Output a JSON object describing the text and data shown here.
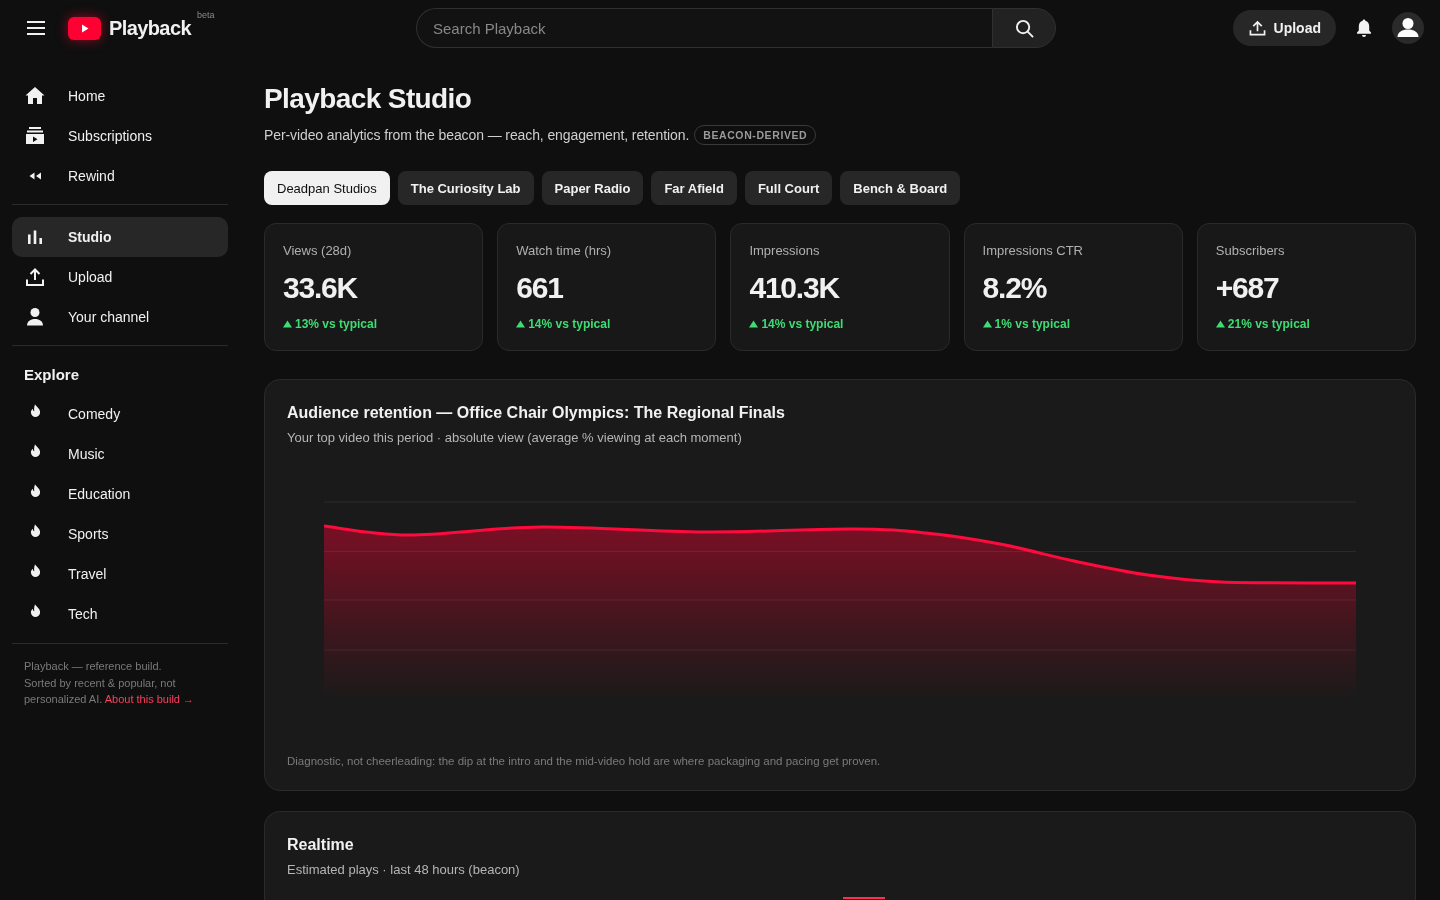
{
  "topbar": {
    "logo": {
      "name": "Playback",
      "badge": "beta"
    },
    "search": {
      "placeholder": "Search Playback"
    },
    "upload_button": "Upload"
  },
  "sidebar": {
    "groups": [
      {
        "items": [
          {
            "label": "Home",
            "kind": "home",
            "selected": false
          },
          {
            "label": "Subscriptions",
            "kind": "subscriptions",
            "selected": false
          },
          {
            "label": "Rewind",
            "kind": "rewind",
            "selected": false
          }
        ]
      },
      {
        "items": [
          {
            "label": "Studio",
            "kind": "studio",
            "selected": true
          },
          {
            "label": "Upload",
            "kind": "upload",
            "selected": false
          },
          {
            "label": "Your channel",
            "kind": "channel",
            "selected": false
          }
        ]
      },
      {
        "title": "Explore",
        "items": [
          {
            "label": "Comedy",
            "kind": "category",
            "selected": false
          },
          {
            "label": "Music",
            "kind": "category",
            "selected": false
          },
          {
            "label": "Education",
            "kind": "category",
            "selected": false
          },
          {
            "label": "Sports",
            "kind": "category",
            "selected": false
          },
          {
            "label": "Travel",
            "kind": "category",
            "selected": false
          },
          {
            "label": "Tech",
            "kind": "category",
            "selected": false
          }
        ]
      }
    ],
    "footer": {
      "credit": "Playback — reference build.",
      "note": "Sorted by recent & popular, not personalized AI.",
      "link": "About this build →"
    }
  },
  "page": {
    "title": "Playback Studio",
    "subtitle": "Per-video analytics from the beacon — reach, engagement, retention.",
    "tag": "BEACON-DERIVED"
  },
  "tabs": [
    {
      "label": "Deadpan Studios",
      "selected": true
    },
    {
      "label": "The Curiosity Lab",
      "selected": false
    },
    {
      "label": "Paper Radio",
      "selected": false
    },
    {
      "label": "Far Afield",
      "selected": false
    },
    {
      "label": "Full Court",
      "selected": false
    },
    {
      "label": "Bench & Board",
      "selected": false
    }
  ],
  "stats": [
    {
      "label": "Views (28d)",
      "value": "33.6K",
      "rising": true,
      "delta": "13% vs typical"
    },
    {
      "label": "Watch time (hrs)",
      "value": "661",
      "rising": true,
      "delta": "14% vs typical"
    },
    {
      "label": "Impressions",
      "value": "410.3K",
      "rising": true,
      "delta": "14% vs typical"
    },
    {
      "label": "Impressions CTR",
      "value": "8.2%",
      "rising": true,
      "delta": "1% vs typical"
    },
    {
      "label": "Subscribers",
      "value": "+687",
      "rising": true,
      "delta": "21% vs typical"
    }
  ],
  "retention": {
    "title": "Audience retention — Office Chair Olympics: The Regional Finals",
    "subtitle": "Your top video this period · absolute view (average % viewing at each moment)",
    "footnote": "Diagnostic, not cheerleading: the dip at the intro and the mid-video hold are where packaging and pacing get proven."
  },
  "realtime": {
    "title": "Realtime",
    "subtitle": "Estimated plays · last 48 hours (beacon)"
  }
}
